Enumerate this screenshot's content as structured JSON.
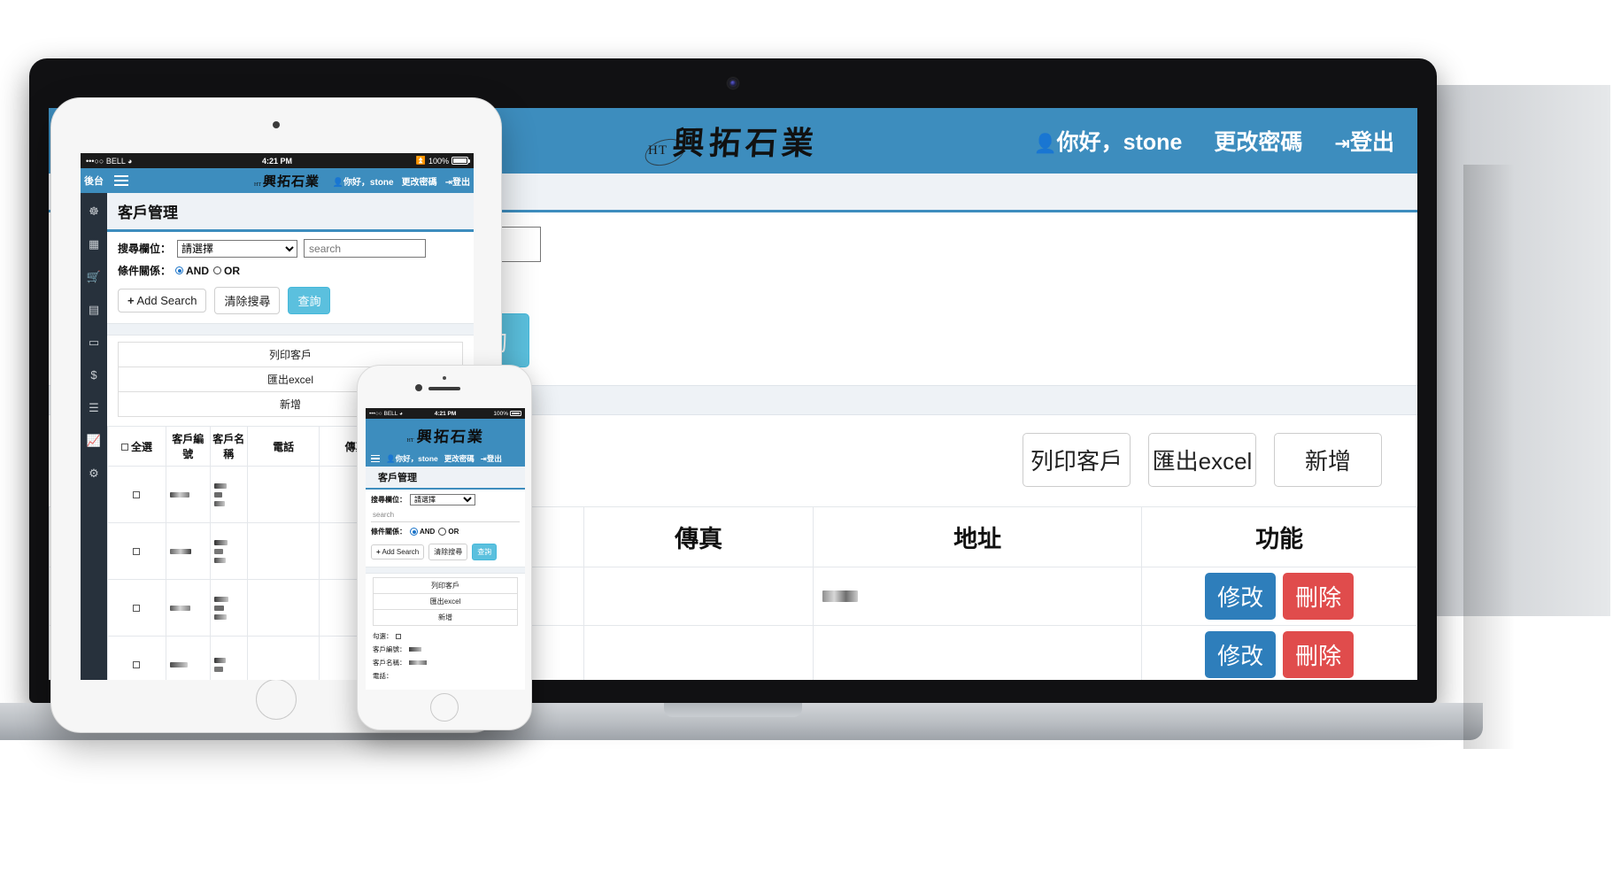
{
  "brand": {
    "mark": "HT",
    "name": "興拓石業"
  },
  "header": {
    "greeting": "你好，stone",
    "change_password": "更改密碼",
    "logout": "登出",
    "user_icon": "user-icon",
    "logout_icon": "logout-icon",
    "bg_color": "#3d8dbe"
  },
  "page": {
    "title": "客戶管理",
    "sidebar_title": "後台"
  },
  "search": {
    "field_label": "搜尋欄位：",
    "field_selected": "請選擇",
    "field_options": [
      "請選擇"
    ],
    "keyword_placeholder": "search",
    "keyword_value": "",
    "relation_label": "條件關係：",
    "relation_and": "AND",
    "relation_or": "OR",
    "relation_selected": "AND",
    "add_search": "Add Search",
    "add_search_icon": "plus-icon",
    "clear_search": "清除搜尋",
    "submit": "查詢"
  },
  "toolbar": {
    "print": "列印客戶",
    "export": "匯出excel",
    "create": "新增"
  },
  "table": {
    "columns": [
      "全選",
      "客戶編號",
      "客戶名稱",
      "電話",
      "傳真",
      "地址",
      "功能"
    ],
    "select_all_label": "全選",
    "rows": [
      {
        "id": "row-1",
        "edit": "修改",
        "delete": "刪除"
      },
      {
        "id": "row-2",
        "edit": "修改",
        "delete": "刪除"
      },
      {
        "id": "row-3",
        "edit": "修改",
        "delete": "刪除"
      },
      {
        "id": "row-4",
        "edit": "修改",
        "delete": "刪除"
      }
    ],
    "action_edit": "修改",
    "action_delete": "刪除",
    "edit_color": "#2e7ebb",
    "delete_color": "#e04c4c"
  },
  "phone_fields": {
    "check": "勾選：",
    "customer_id": "客戶編號：",
    "customer_name": "客戶名稱：",
    "phone": "電話："
  },
  "device_status": {
    "carrier": "BELL",
    "signal": "•••○○",
    "wifi": "wifi-icon",
    "time": "4:21 PM",
    "bluetooth": "bluetooth-icon",
    "battery": "100%"
  },
  "sidebar_icons": [
    "dashboard-icon",
    "window-icon",
    "cart-icon",
    "toggle-icon",
    "card-icon",
    "dollar-icon",
    "list-icon",
    "chart-icon",
    "gear-icon"
  ]
}
